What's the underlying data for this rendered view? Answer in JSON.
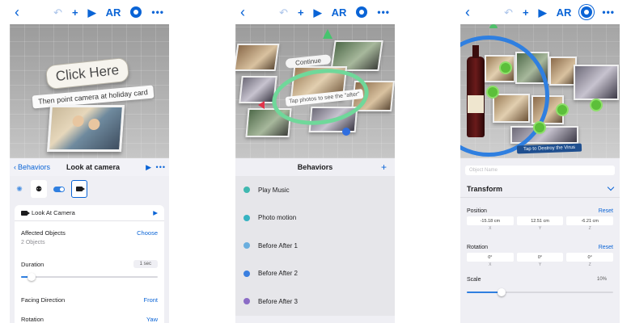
{
  "colors": {
    "accent": "#0a64d6",
    "slider": "#2f7fe0",
    "ar_ring_green": "#6fd89a",
    "ar_ring_blue": "#2f7fe0"
  },
  "toolbar": {
    "ar_label": "AR"
  },
  "screen1": {
    "scene": {
      "headline": "Click Here",
      "instruction": "Then point camera at holiday card"
    },
    "header": {
      "back_label": "Behaviors",
      "title": "Look at camera"
    },
    "action": {
      "label": "Look At Camera"
    },
    "affected": {
      "label": "Affected Objects",
      "value": "2 Objects",
      "action": "Choose"
    },
    "duration": {
      "label": "Duration",
      "value": "1 sec",
      "slider_fraction": 0.05
    },
    "facing": {
      "label": "Facing Direction",
      "value": "Front"
    },
    "rotation": {
      "label": "Rotation",
      "value": "Yaw"
    }
  },
  "screen2": {
    "scene": {
      "continue_label": "Continue",
      "hint": "Tap photos to see the \"after\""
    },
    "header": {
      "title": "Behaviors"
    },
    "behaviors": [
      {
        "name": "Play Music",
        "color": "#3fb8b0"
      },
      {
        "name": "Photo motion",
        "color": "#36b3c2"
      },
      {
        "name": "Before After 1",
        "color": "#6aaede"
      },
      {
        "name": "Before After 2",
        "color": "#3a7fe0"
      },
      {
        "name": "Before After 3",
        "color": "#8b6cc6"
      }
    ]
  },
  "screen3": {
    "scene": {
      "sign": "Tap to Destroy the Virus"
    },
    "object_name_placeholder": "Object Name",
    "transform": {
      "title": "Transform"
    },
    "position": {
      "label": "Position",
      "reset": "Reset",
      "x": "-15.18 cm",
      "y": "12.51 cm",
      "z": "-6.21 cm"
    },
    "rotation": {
      "label": "Rotation",
      "reset": "Reset",
      "x": "0°",
      "y": "0°",
      "z": "0°"
    },
    "axes": {
      "x": "X",
      "y": "Y",
      "z": "Z"
    },
    "scale": {
      "label": "Scale",
      "value": "10%",
      "slider_fraction": 0.22
    }
  }
}
